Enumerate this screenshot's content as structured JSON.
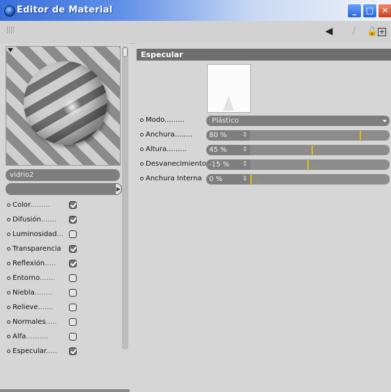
{
  "window": {
    "title": "Editor de Material"
  },
  "toolbar": {
    "back_icon": "arrow-left-icon",
    "forward_icon": "arrow-right-icon",
    "lock_icon": "lock-icon",
    "add_icon": "add-icon"
  },
  "material": {
    "name": "vidrio2"
  },
  "channels": [
    {
      "label": "Color",
      "dots": ".........",
      "checked": true
    },
    {
      "label": "Difusión",
      "dots": ".......",
      "checked": true
    },
    {
      "label": "Luminosidad",
      "dots": "...",
      "checked": false
    },
    {
      "label": "Transparencia",
      "dots": "",
      "checked": true
    },
    {
      "label": "Reflexión",
      "dots": ".....",
      "checked": true
    },
    {
      "label": "Entorno",
      "dots": ".......",
      "checked": false
    },
    {
      "label": "Niebla",
      "dots": "........",
      "checked": false
    },
    {
      "label": "Relieve",
      "dots": ".......",
      "checked": false
    },
    {
      "label": "Normales",
      "dots": ".....",
      "checked": false
    },
    {
      "label": "Alfa",
      "dots": "..........",
      "checked": false
    },
    {
      "label": "Especular",
      "dots": ".....",
      "checked": true
    }
  ],
  "specular": {
    "title": "Especular",
    "mode": {
      "label": "Modo",
      "dots": ".........",
      "value": "Plástico"
    },
    "params": [
      {
        "label": "Anchura",
        "dots": "........",
        "value": "80 %",
        "fraction": 0.8
      },
      {
        "label": "Altura",
        "dots": ".........",
        "value": "45 %",
        "fraction": 0.45
      },
      {
        "label": "Desvanecimiento",
        "dots": "",
        "value": "-15 %",
        "fraction": 0.42
      },
      {
        "label": "Anchura Interna",
        "dots": "",
        "value": "0 %",
        "fraction": 0.0
      }
    ]
  },
  "colors": {
    "accent": "#e8c400",
    "titlebar": "#3a6fd9"
  }
}
